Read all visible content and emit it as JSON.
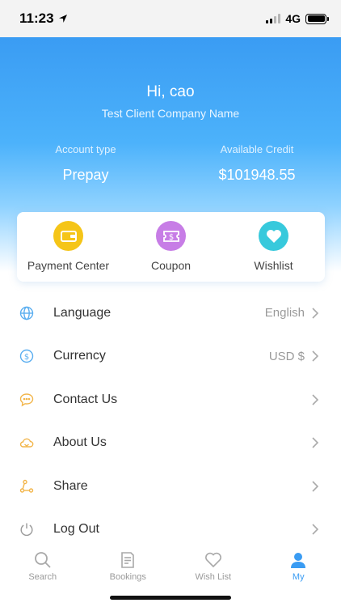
{
  "status_bar": {
    "time": "11:23",
    "network": "4G"
  },
  "header": {
    "greeting": "Hi, cao",
    "company": "Test Client Company Name",
    "account_type_label": "Account type",
    "account_type_value": "Prepay",
    "credit_label": "Available Credit",
    "credit_value": "$101948.55"
  },
  "quick_actions": [
    {
      "label": "Payment Center",
      "icon": "wallet-icon",
      "color": "#f5c518"
    },
    {
      "label": "Coupon",
      "icon": "coupon-icon",
      "color": "#c77de6"
    },
    {
      "label": "Wishlist",
      "icon": "heart-icon",
      "color": "#37c9dc"
    }
  ],
  "menu": [
    {
      "label": "Language",
      "value": "English",
      "icon": "globe-icon"
    },
    {
      "label": "Currency",
      "value": "USD $",
      "icon": "dollar-circle-icon"
    },
    {
      "label": "Contact Us",
      "value": "",
      "icon": "chat-icon"
    },
    {
      "label": "About Us",
      "value": "",
      "icon": "cloud-icon"
    },
    {
      "label": "Share",
      "value": "",
      "icon": "share-icon"
    },
    {
      "label": "Log Out",
      "value": "",
      "icon": "power-icon"
    }
  ],
  "tabs": [
    {
      "label": "Search",
      "icon": "search-icon"
    },
    {
      "label": "Bookings",
      "icon": "document-icon"
    },
    {
      "label": "Wish List",
      "icon": "heart-outline-icon"
    },
    {
      "label": "My",
      "icon": "person-icon",
      "active": true
    }
  ],
  "colors": {
    "accent": "#3a9cf3",
    "menu_icon_blue": "#5aaef0",
    "menu_icon_orange": "#f2b54a"
  }
}
